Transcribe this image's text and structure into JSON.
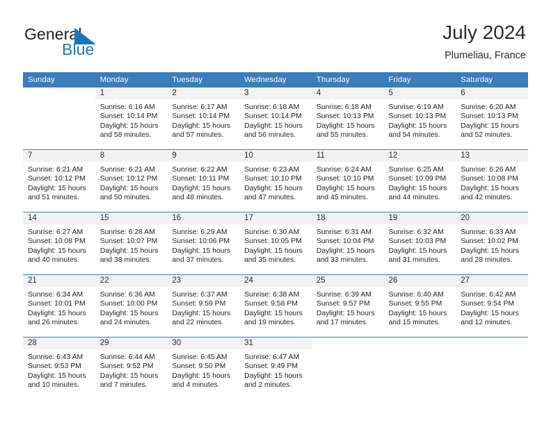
{
  "brand": {
    "name_part1": "General",
    "name_part2": "Blue",
    "accent_color": "#1b75bb",
    "triangle_color": "#1b75bb"
  },
  "header": {
    "title": "July 2024",
    "subtitle": "Plumeliau, France"
  },
  "theme": {
    "header_bg": "#3b7cbd",
    "header_text": "#ffffff",
    "daynum_bg": "#f2f2f2",
    "row_divider": "#3b7cbd",
    "body_text": "#231f20"
  },
  "weekdays": [
    "Sunday",
    "Monday",
    "Tuesday",
    "Wednesday",
    "Thursday",
    "Friday",
    "Saturday"
  ],
  "weeks": [
    [
      {
        "day": "",
        "blank": true
      },
      {
        "day": "1",
        "sunrise": "Sunrise: 6:16 AM",
        "sunset": "Sunset: 10:14 PM",
        "daylight1": "Daylight: 15 hours",
        "daylight2": "and 58 minutes."
      },
      {
        "day": "2",
        "sunrise": "Sunrise: 6:17 AM",
        "sunset": "Sunset: 10:14 PM",
        "daylight1": "Daylight: 15 hours",
        "daylight2": "and 57 minutes."
      },
      {
        "day": "3",
        "sunrise": "Sunrise: 6:18 AM",
        "sunset": "Sunset: 10:14 PM",
        "daylight1": "Daylight: 15 hours",
        "daylight2": "and 56 minutes."
      },
      {
        "day": "4",
        "sunrise": "Sunrise: 6:18 AM",
        "sunset": "Sunset: 10:13 PM",
        "daylight1": "Daylight: 15 hours",
        "daylight2": "and 55 minutes."
      },
      {
        "day": "5",
        "sunrise": "Sunrise: 6:19 AM",
        "sunset": "Sunset: 10:13 PM",
        "daylight1": "Daylight: 15 hours",
        "daylight2": "and 54 minutes."
      },
      {
        "day": "6",
        "sunrise": "Sunrise: 6:20 AM",
        "sunset": "Sunset: 10:13 PM",
        "daylight1": "Daylight: 15 hours",
        "daylight2": "and 52 minutes."
      }
    ],
    [
      {
        "day": "7",
        "sunrise": "Sunrise: 6:21 AM",
        "sunset": "Sunset: 10:12 PM",
        "daylight1": "Daylight: 15 hours",
        "daylight2": "and 51 minutes."
      },
      {
        "day": "8",
        "sunrise": "Sunrise: 6:21 AM",
        "sunset": "Sunset: 10:12 PM",
        "daylight1": "Daylight: 15 hours",
        "daylight2": "and 50 minutes."
      },
      {
        "day": "9",
        "sunrise": "Sunrise: 6:22 AM",
        "sunset": "Sunset: 10:11 PM",
        "daylight1": "Daylight: 15 hours",
        "daylight2": "and 48 minutes."
      },
      {
        "day": "10",
        "sunrise": "Sunrise: 6:23 AM",
        "sunset": "Sunset: 10:10 PM",
        "daylight1": "Daylight: 15 hours",
        "daylight2": "and 47 minutes."
      },
      {
        "day": "11",
        "sunrise": "Sunrise: 6:24 AM",
        "sunset": "Sunset: 10:10 PM",
        "daylight1": "Daylight: 15 hours",
        "daylight2": "and 45 minutes."
      },
      {
        "day": "12",
        "sunrise": "Sunrise: 6:25 AM",
        "sunset": "Sunset: 10:09 PM",
        "daylight1": "Daylight: 15 hours",
        "daylight2": "and 44 minutes."
      },
      {
        "day": "13",
        "sunrise": "Sunrise: 6:26 AM",
        "sunset": "Sunset: 10:08 PM",
        "daylight1": "Daylight: 15 hours",
        "daylight2": "and 42 minutes."
      }
    ],
    [
      {
        "day": "14",
        "sunrise": "Sunrise: 6:27 AM",
        "sunset": "Sunset: 10:08 PM",
        "daylight1": "Daylight: 15 hours",
        "daylight2": "and 40 minutes."
      },
      {
        "day": "15",
        "sunrise": "Sunrise: 6:28 AM",
        "sunset": "Sunset: 10:07 PM",
        "daylight1": "Daylight: 15 hours",
        "daylight2": "and 38 minutes."
      },
      {
        "day": "16",
        "sunrise": "Sunrise: 6:29 AM",
        "sunset": "Sunset: 10:06 PM",
        "daylight1": "Daylight: 15 hours",
        "daylight2": "and 37 minutes."
      },
      {
        "day": "17",
        "sunrise": "Sunrise: 6:30 AM",
        "sunset": "Sunset: 10:05 PM",
        "daylight1": "Daylight: 15 hours",
        "daylight2": "and 35 minutes."
      },
      {
        "day": "18",
        "sunrise": "Sunrise: 6:31 AM",
        "sunset": "Sunset: 10:04 PM",
        "daylight1": "Daylight: 15 hours",
        "daylight2": "and 33 minutes."
      },
      {
        "day": "19",
        "sunrise": "Sunrise: 6:32 AM",
        "sunset": "Sunset: 10:03 PM",
        "daylight1": "Daylight: 15 hours",
        "daylight2": "and 31 minutes."
      },
      {
        "day": "20",
        "sunrise": "Sunrise: 6:33 AM",
        "sunset": "Sunset: 10:02 PM",
        "daylight1": "Daylight: 15 hours",
        "daylight2": "and 28 minutes."
      }
    ],
    [
      {
        "day": "21",
        "sunrise": "Sunrise: 6:34 AM",
        "sunset": "Sunset: 10:01 PM",
        "daylight1": "Daylight: 15 hours",
        "daylight2": "and 26 minutes."
      },
      {
        "day": "22",
        "sunrise": "Sunrise: 6:36 AM",
        "sunset": "Sunset: 10:00 PM",
        "daylight1": "Daylight: 15 hours",
        "daylight2": "and 24 minutes."
      },
      {
        "day": "23",
        "sunrise": "Sunrise: 6:37 AM",
        "sunset": "Sunset: 9:59 PM",
        "daylight1": "Daylight: 15 hours",
        "daylight2": "and 22 minutes."
      },
      {
        "day": "24",
        "sunrise": "Sunrise: 6:38 AM",
        "sunset": "Sunset: 9:58 PM",
        "daylight1": "Daylight: 15 hours",
        "daylight2": "and 19 minutes."
      },
      {
        "day": "25",
        "sunrise": "Sunrise: 6:39 AM",
        "sunset": "Sunset: 9:57 PM",
        "daylight1": "Daylight: 15 hours",
        "daylight2": "and 17 minutes."
      },
      {
        "day": "26",
        "sunrise": "Sunrise: 6:40 AM",
        "sunset": "Sunset: 9:55 PM",
        "daylight1": "Daylight: 15 hours",
        "daylight2": "and 15 minutes."
      },
      {
        "day": "27",
        "sunrise": "Sunrise: 6:42 AM",
        "sunset": "Sunset: 9:54 PM",
        "daylight1": "Daylight: 15 hours",
        "daylight2": "and 12 minutes."
      }
    ],
    [
      {
        "day": "28",
        "sunrise": "Sunrise: 6:43 AM",
        "sunset": "Sunset: 9:53 PM",
        "daylight1": "Daylight: 15 hours",
        "daylight2": "and 10 minutes."
      },
      {
        "day": "29",
        "sunrise": "Sunrise: 6:44 AM",
        "sunset": "Sunset: 9:52 PM",
        "daylight1": "Daylight: 15 hours",
        "daylight2": "and 7 minutes."
      },
      {
        "day": "30",
        "sunrise": "Sunrise: 6:45 AM",
        "sunset": "Sunset: 9:50 PM",
        "daylight1": "Daylight: 15 hours",
        "daylight2": "and 4 minutes."
      },
      {
        "day": "31",
        "sunrise": "Sunrise: 6:47 AM",
        "sunset": "Sunset: 9:49 PM",
        "daylight1": "Daylight: 15 hours",
        "daylight2": "and 2 minutes."
      },
      {
        "day": "",
        "blank": true
      },
      {
        "day": "",
        "blank": true
      },
      {
        "day": "",
        "blank": true
      }
    ]
  ]
}
